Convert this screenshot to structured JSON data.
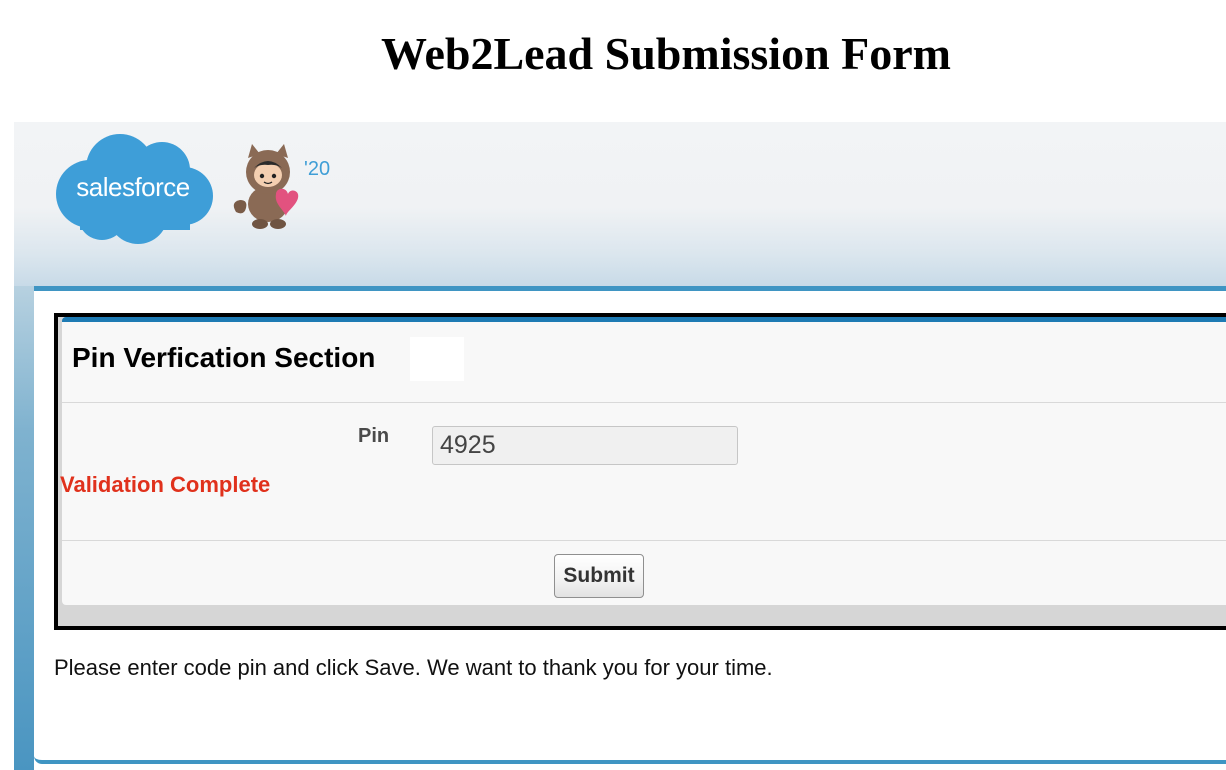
{
  "page": {
    "heading": "Web2Lead Submission Form"
  },
  "header": {
    "logo_text": "salesforce",
    "release_badge": "'20"
  },
  "form": {
    "section_title": "Pin Verfication Section",
    "pin_label": "Pin",
    "pin_value": "4925",
    "validation_message": "Validation Complete",
    "submit_label": "Submit"
  },
  "footer": {
    "instructions": "Please enter code pin and click Save. We want to thank you for your time."
  },
  "colors": {
    "brand_blue": "#3f95c3",
    "panel_accent": "#1e7bb4",
    "validation_red": "#e0311c"
  },
  "icons": {
    "logo": "salesforce-cloud-logo",
    "mascot": "astro-mascot-icon"
  }
}
